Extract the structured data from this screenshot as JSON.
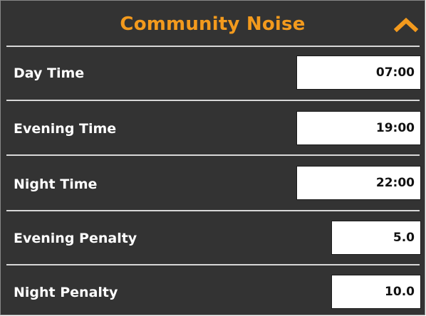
{
  "header": {
    "title": "Community Noise",
    "collapse_icon": "chevron-up-icon"
  },
  "colors": {
    "panel_bg": "#333333",
    "title_accent": "#f39a1d",
    "divider": "#d8d8d8",
    "field_bg": "#ffffff"
  },
  "rows": [
    {
      "label": "Day Time",
      "value": "07:00"
    },
    {
      "label": "Evening Time",
      "value": "19:00"
    },
    {
      "label": "Night Time",
      "value": "22:00"
    },
    {
      "label": "Evening Penalty",
      "value": "5.0"
    },
    {
      "label": "Night Penalty",
      "value": "10.0"
    }
  ]
}
